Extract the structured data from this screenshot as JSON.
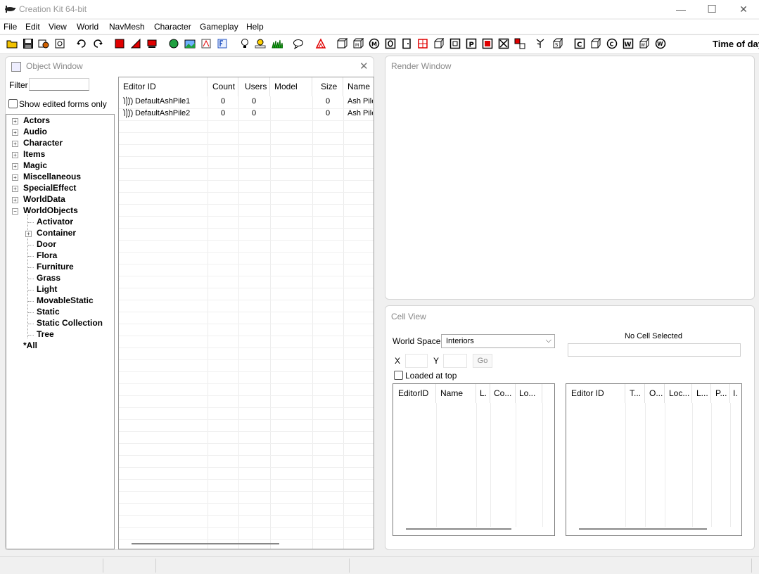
{
  "window": {
    "title": "Creation Kit 64-bit",
    "minimize": "—",
    "maximize": "☐",
    "close": "✕"
  },
  "menu": [
    "File",
    "Edit",
    "View",
    "World",
    "NavMesh",
    "Character",
    "Gameplay",
    "Help"
  ],
  "toolbar": {
    "time_label": "Time of day"
  },
  "object_window": {
    "title": "Object Window",
    "filter_label": "Filter",
    "filter_value": "",
    "show_edited_label": "Show edited forms only",
    "tree": [
      {
        "label": "Actors",
        "expandable": true,
        "level": 0
      },
      {
        "label": "Audio",
        "expandable": true,
        "level": 0
      },
      {
        "label": "Character",
        "expandable": true,
        "level": 0
      },
      {
        "label": "Items",
        "expandable": true,
        "level": 0
      },
      {
        "label": "Magic",
        "expandable": true,
        "level": 0
      },
      {
        "label": "Miscellaneous",
        "expandable": true,
        "level": 0
      },
      {
        "label": "SpecialEffect",
        "expandable": true,
        "level": 0
      },
      {
        "label": "WorldData",
        "expandable": true,
        "level": 0
      },
      {
        "label": "WorldObjects",
        "expandable": true,
        "expanded": true,
        "level": 0
      },
      {
        "label": "Activator",
        "level": 1
      },
      {
        "label": "Container",
        "expandable": true,
        "level": 1
      },
      {
        "label": "Door",
        "level": 1
      },
      {
        "label": "Flora",
        "level": 1
      },
      {
        "label": "Furniture",
        "level": 1
      },
      {
        "label": "Grass",
        "level": 1
      },
      {
        "label": "Light",
        "level": 1
      },
      {
        "label": "MovableStatic",
        "level": 1
      },
      {
        "label": "Static",
        "level": 1
      },
      {
        "label": "Static Collection",
        "level": 1
      },
      {
        "label": "Tree",
        "level": 1
      },
      {
        "label": "*All",
        "level": 0
      }
    ],
    "columns": [
      "Editor ID",
      "Count",
      "Users",
      "Model",
      "Size",
      "Name"
    ],
    "rows": [
      {
        "editor_id": "DefaultAshPile1",
        "count": "0",
        "users": "0",
        "model": "",
        "size": "0",
        "name": "Ash Pile"
      },
      {
        "editor_id": "DefaultAshPile2",
        "count": "0",
        "users": "0",
        "model": "",
        "size": "0",
        "name": "Ash Pile"
      }
    ]
  },
  "render_window": {
    "title": "Render Window"
  },
  "cell_view": {
    "title": "Cell View",
    "world_space_label": "World Space",
    "world_space_value": "Interiors",
    "x_label": "X",
    "y_label": "Y",
    "go_label": "Go",
    "loaded_at_top_label": "Loaded at top",
    "no_cell_label": "No Cell Selected",
    "cells_columns": [
      "EditorID",
      "Name",
      "L.",
      "Co...",
      "Lo..."
    ],
    "refs_columns": [
      "Editor ID",
      "T...",
      "O...",
      "Loc...",
      "L...",
      "P...",
      "I."
    ]
  },
  "colors": {
    "panel_border": "#d5d5d5",
    "list_border": "#9a9a9a",
    "title_grey": "#888888"
  }
}
